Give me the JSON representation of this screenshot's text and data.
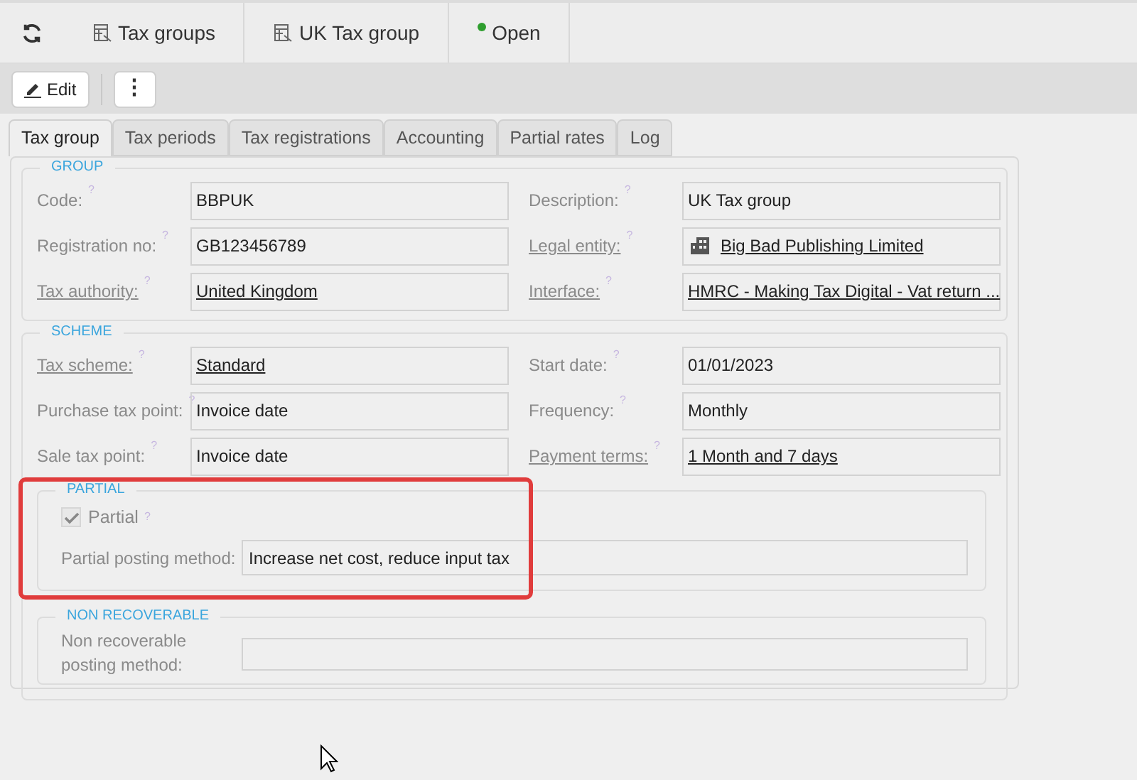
{
  "breadcrumbs": [
    {
      "label": "Tax groups",
      "kind": "table"
    },
    {
      "label": "UK Tax group",
      "kind": "table"
    },
    {
      "label": "Open",
      "kind": "status",
      "color": "#2e9e2e"
    }
  ],
  "toolbar": {
    "edit": "Edit",
    "more": "⋮"
  },
  "tabs": [
    {
      "label": "Tax group",
      "selected": true
    },
    {
      "label": "Tax periods",
      "selected": false
    },
    {
      "label": "Tax registrations",
      "selected": false
    },
    {
      "label": "Accounting",
      "selected": false
    },
    {
      "label": "Partial rates",
      "selected": false
    },
    {
      "label": "Log",
      "selected": false
    }
  ],
  "sections": [
    {
      "title": "GROUP",
      "rows": [
        [
          {
            "label": "Code:",
            "help": "?",
            "link_label": false,
            "value": "BBPUK",
            "link": false
          },
          {
            "label": "Description:",
            "help": "?",
            "link_label": false,
            "value": "UK Tax group",
            "link": false
          }
        ],
        [
          {
            "label": "Registration no:",
            "help": "?",
            "link_label": false,
            "value": "GB123456789",
            "link": false
          },
          {
            "label": "Legal entity:",
            "help": "?",
            "link_label": true,
            "value": "Big Bad Publishing Limited",
            "link": true,
            "kind": "entity"
          }
        ],
        [
          {
            "label": "Tax authority:",
            "help": "?",
            "link_label": true,
            "value": "United Kingdom",
            "link": true
          },
          {
            "label": "Interface:",
            "help": "?",
            "link_label": true,
            "value": "HMRC - Making Tax Digital - Vat return ...",
            "link": true
          }
        ]
      ]
    },
    {
      "title": "SCHEME",
      "rows": [
        [
          {
            "label": "Tax scheme:",
            "help": "?",
            "link_label": true,
            "value": "Standard",
            "link": true
          },
          {
            "label": "Start date:",
            "help": "?",
            "link_label": false,
            "value": "01/01/2023",
            "link": false
          }
        ],
        [
          {
            "label": "Purchase tax point:",
            "help": "?",
            "link_label": false,
            "value": "Invoice date",
            "link": false
          },
          {
            "label": "Frequency:",
            "help": "?",
            "link_label": false,
            "value": "Monthly",
            "link": false
          }
        ],
        [
          {
            "label": "Sale tax point:",
            "help": "?",
            "link_label": false,
            "value": "Invoice date",
            "link": false
          },
          {
            "label": "Payment terms:",
            "help": "?",
            "link_label": true,
            "value": "1 Month and 7 days",
            "link": true
          }
        ]
      ],
      "partial": {
        "title": "PARTIAL",
        "checkbox": {
          "label": "Partial",
          "help": "?",
          "checked": true
        },
        "method_label": "Partial posting method:",
        "method_value": "Increase net cost, reduce input tax"
      },
      "non_recoverable": {
        "title": "NON RECOVERABLE",
        "method_label": "Non recoverable posting method:"
      }
    }
  ]
}
